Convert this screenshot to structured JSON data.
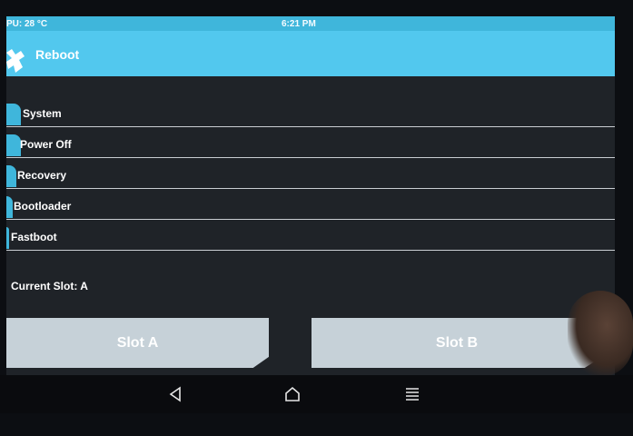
{
  "status_bar": {
    "cpu": "PU: 28 °C",
    "time": "6:21 PM"
  },
  "header": {
    "title": "Reboot"
  },
  "menu": {
    "items": [
      {
        "label": "System"
      },
      {
        "label": "Power Off"
      },
      {
        "label": "Recovery"
      },
      {
        "label": "Bootloader"
      },
      {
        "label": "Fastboot"
      }
    ]
  },
  "current_slot": "Current Slot: A",
  "buttons": {
    "slot_a": "Slot A",
    "slot_b": "Slot B"
  },
  "nav": {
    "back_icon": "back-triangle-icon",
    "home_icon": "home-icon",
    "menu_icon": "menu-icon"
  },
  "colors": {
    "accent": "#52c8ee",
    "status": "#3fb6db",
    "background": "#1f2328",
    "button": "#c6d1d8"
  }
}
